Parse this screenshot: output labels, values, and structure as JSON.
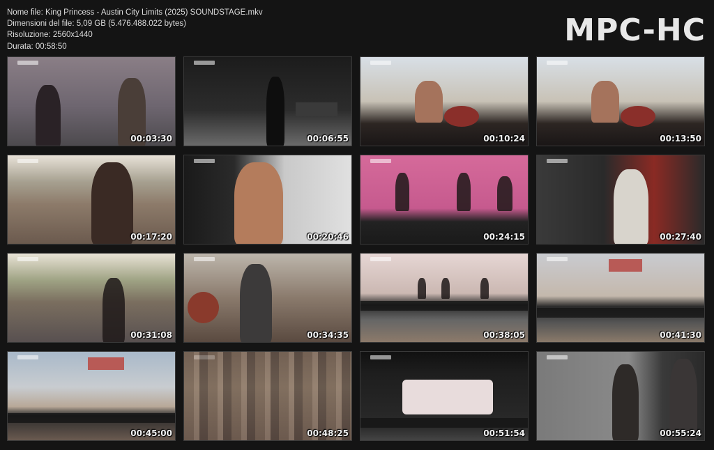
{
  "info": {
    "line1": "Nome file: King Princess - Austin City Limits (2025) SOUNDSTAGE.mkv",
    "line2": "Dimensioni del file: 5,09 GB (5.476.488.022 bytes)",
    "line3": "Risoluzione: 2560x1440",
    "line4": "Durata: 00:58:50"
  },
  "brand": "MPC-HC",
  "thumbnails": [
    {
      "time": "00:03:30"
    },
    {
      "time": "00:06:55"
    },
    {
      "time": "00:10:24"
    },
    {
      "time": "00:13:50"
    },
    {
      "time": "00:17:20"
    },
    {
      "time": "00:20:46"
    },
    {
      "time": "00:24:15"
    },
    {
      "time": "00:27:40"
    },
    {
      "time": "00:31:08"
    },
    {
      "time": "00:34:35"
    },
    {
      "time": "00:38:05"
    },
    {
      "time": "00:41:30"
    },
    {
      "time": "00:45:00"
    },
    {
      "time": "00:48:25"
    },
    {
      "time": "00:51:54"
    },
    {
      "time": "00:55:24"
    }
  ]
}
